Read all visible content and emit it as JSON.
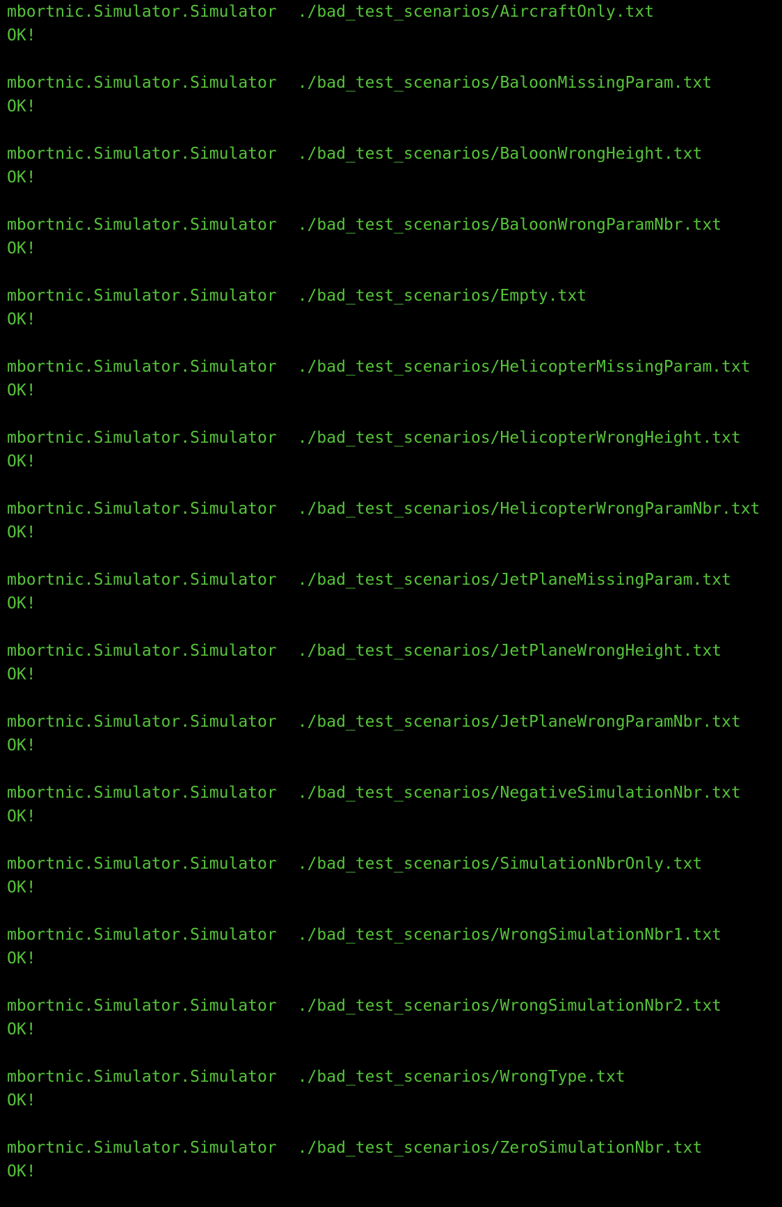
{
  "terminal": {
    "text_color": "#56C33A",
    "background_color": "#000000",
    "entries": [
      {
        "class_name": "mbortnic.Simulator.Simulator",
        "path": "./bad_test_scenarios/AircraftOnly.txt",
        "result": "OK!"
      },
      {
        "class_name": "mbortnic.Simulator.Simulator",
        "path": "./bad_test_scenarios/BaloonMissingParam.txt",
        "result": "OK!"
      },
      {
        "class_name": "mbortnic.Simulator.Simulator",
        "path": "./bad_test_scenarios/BaloonWrongHeight.txt",
        "result": "OK!"
      },
      {
        "class_name": "mbortnic.Simulator.Simulator",
        "path": "./bad_test_scenarios/BaloonWrongParamNbr.txt",
        "result": "OK!"
      },
      {
        "class_name": "mbortnic.Simulator.Simulator",
        "path": "./bad_test_scenarios/Empty.txt",
        "result": "OK!"
      },
      {
        "class_name": "mbortnic.Simulator.Simulator",
        "path": "./bad_test_scenarios/HelicopterMissingParam.txt",
        "result": "OK!"
      },
      {
        "class_name": "mbortnic.Simulator.Simulator",
        "path": "./bad_test_scenarios/HelicopterWrongHeight.txt",
        "result": "OK!"
      },
      {
        "class_name": "mbortnic.Simulator.Simulator",
        "path": "./bad_test_scenarios/HelicopterWrongParamNbr.txt",
        "result": "OK!"
      },
      {
        "class_name": "mbortnic.Simulator.Simulator",
        "path": "./bad_test_scenarios/JetPlaneMissingParam.txt",
        "result": "OK!"
      },
      {
        "class_name": "mbortnic.Simulator.Simulator",
        "path": "./bad_test_scenarios/JetPlaneWrongHeight.txt",
        "result": "OK!"
      },
      {
        "class_name": "mbortnic.Simulator.Simulator",
        "path": "./bad_test_scenarios/JetPlaneWrongParamNbr.txt",
        "result": "OK!"
      },
      {
        "class_name": "mbortnic.Simulator.Simulator",
        "path": "./bad_test_scenarios/NegativeSimulationNbr.txt",
        "result": "OK!"
      },
      {
        "class_name": "mbortnic.Simulator.Simulator",
        "path": "./bad_test_scenarios/SimulationNbrOnly.txt",
        "result": "OK!"
      },
      {
        "class_name": "mbortnic.Simulator.Simulator",
        "path": "./bad_test_scenarios/WrongSimulationNbr1.txt",
        "result": "OK!"
      },
      {
        "class_name": "mbortnic.Simulator.Simulator",
        "path": "./bad_test_scenarios/WrongSimulationNbr2.txt",
        "result": "OK!"
      },
      {
        "class_name": "mbortnic.Simulator.Simulator",
        "path": "./bad_test_scenarios/WrongType.txt",
        "result": "OK!"
      },
      {
        "class_name": "mbortnic.Simulator.Simulator",
        "path": "./bad_test_scenarios/ZeroSimulationNbr.txt",
        "result": "OK!"
      }
    ]
  }
}
